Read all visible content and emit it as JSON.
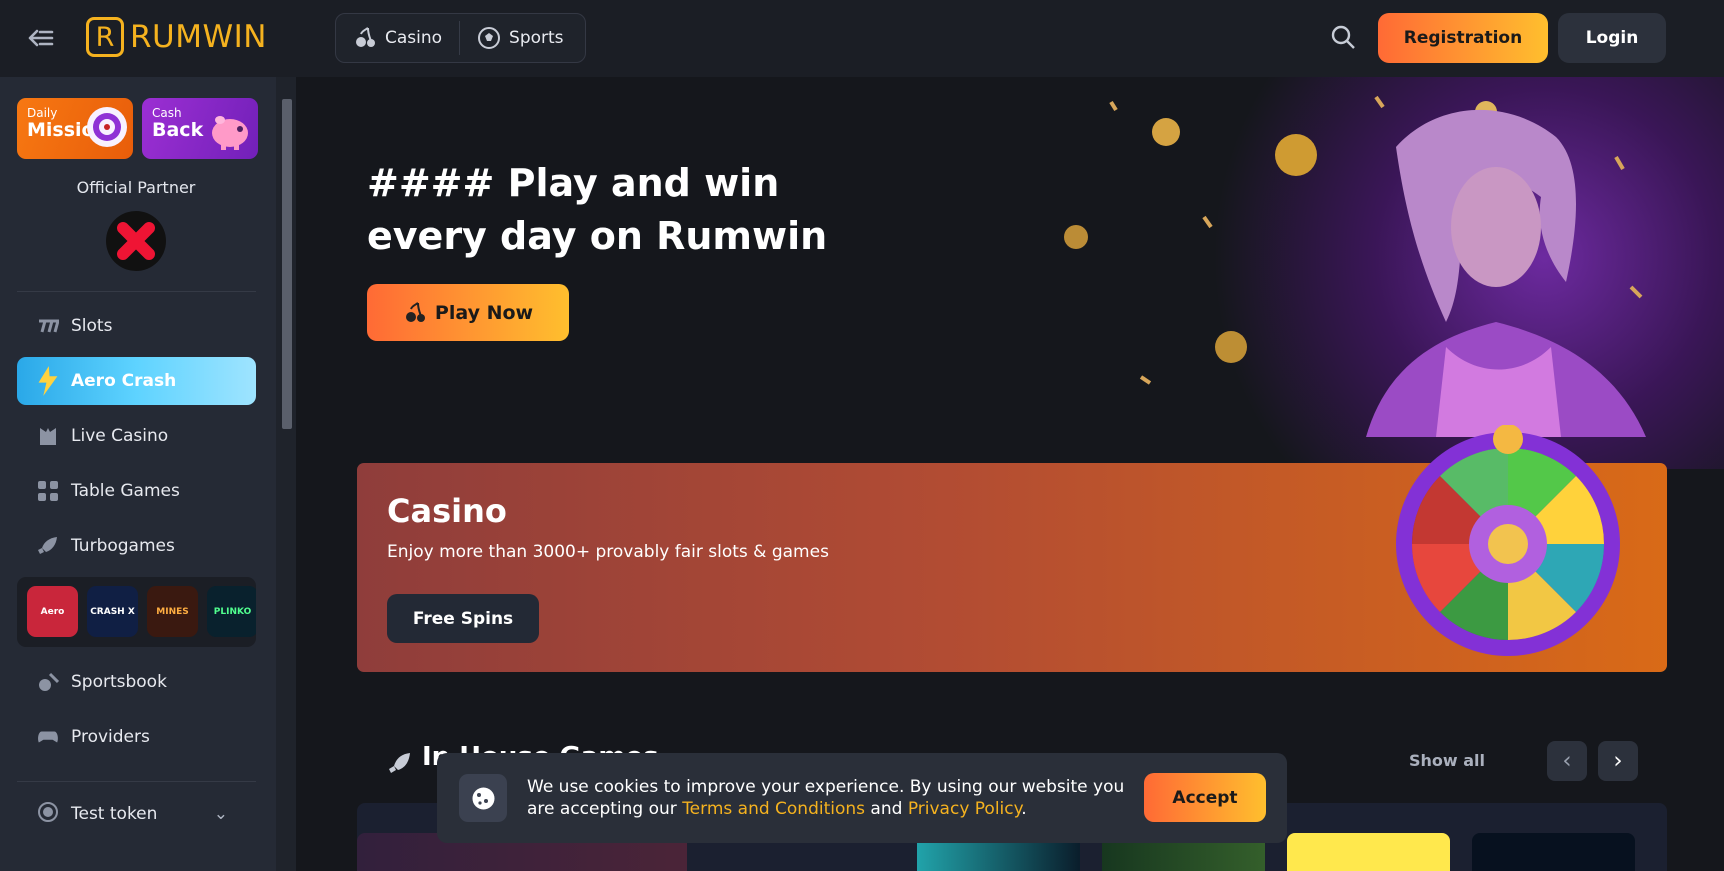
{
  "header": {
    "logo_mark": "R",
    "logo_text": "RUMWIN",
    "tabs": [
      {
        "label": "Casino",
        "icon": "cherry-icon"
      },
      {
        "label": "Sports",
        "icon": "soccer-ball-icon"
      }
    ],
    "registration": "Registration",
    "login": "Login"
  },
  "sidebar": {
    "promos": [
      {
        "small": "Daily",
        "big": "Mission",
        "color": "#f16912"
      },
      {
        "small": "Cash",
        "big": "Back",
        "color": "#8f25c7"
      }
    ],
    "partner": "Official Partner",
    "items": [
      {
        "label": "Slots",
        "icon": "sevens-icon"
      },
      {
        "label": "Aero Crash",
        "icon": "lightning-icon"
      },
      {
        "label": "Live Casino",
        "icon": "dealer-icon"
      },
      {
        "label": "Table Games",
        "icon": "dice-icon"
      },
      {
        "label": "Turbogames",
        "icon": "rocket-icon"
      },
      {
        "label": "Sportsbook",
        "icon": "sports-icon"
      },
      {
        "label": "Providers",
        "icon": "gamepad-icon"
      }
    ],
    "games": [
      {
        "label": "Aero",
        "color": "#c9263b"
      },
      {
        "label": "CRASH X",
        "color": "#101f44"
      },
      {
        "label": "MINES",
        "color": "#3a1910"
      },
      {
        "label": "PLINKO",
        "color": "#09212d"
      }
    ],
    "token": "Test token"
  },
  "hero": {
    "title": "#### Play and win every day on Rumwin",
    "play": "Play Now"
  },
  "casino": {
    "title": "Casino",
    "subtitle": "Enjoy more than 3000+ provably fair slots & games",
    "button": "Free Spins"
  },
  "section": {
    "title": "In House Games",
    "show_all": "Show all"
  },
  "cookie": {
    "text_start": "We use cookies to improve your experience. By using our website you are accepting our ",
    "terms": "Terms and Conditions",
    "middle": " and ",
    "privacy": "Privacy Policy",
    "end": ".",
    "accept": "Accept"
  }
}
